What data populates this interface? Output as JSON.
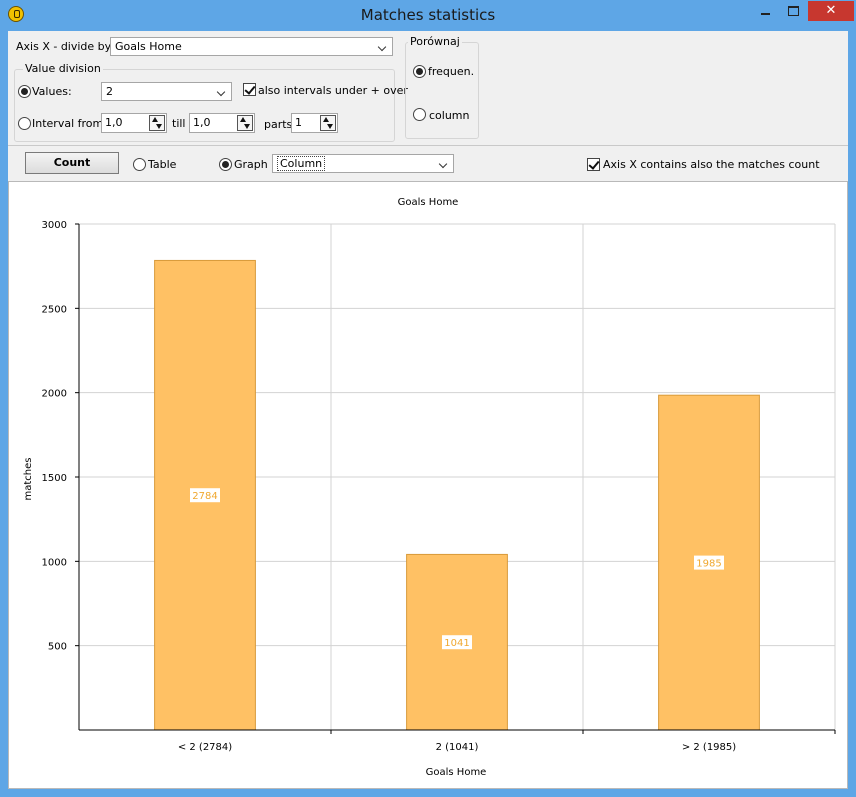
{
  "window": {
    "title": "Matches statistics",
    "close_glyph": "✕"
  },
  "controls": {
    "axis_x_label": "Axis X - divide by",
    "axis_x_value": "Goals Home",
    "value_division_title": "Value division",
    "values_label": "Values:",
    "values_value": "2",
    "also_intervals_label": "also intervals under + over",
    "also_intervals_checked": true,
    "interval_from_label": "Interval from",
    "interval_from_value": "1,0",
    "till_label": "till",
    "till_value": "1,0",
    "parts_label": "parts",
    "parts_value": "1",
    "compare_title": "Porównaj",
    "compare_frequen_label": "frequen.",
    "compare_column_label": "column",
    "values_selected": true,
    "frequen_selected": true
  },
  "toolbar": {
    "count_label": "Count",
    "table_label": "Table",
    "graph_label": "Graph",
    "graph_selected": true,
    "graph_type": "Column",
    "axis_x_count_label": "Axis X contains also the matches count",
    "axis_x_count_checked": true
  },
  "chart_data": {
    "type": "bar",
    "title": "Goals Home",
    "xlabel": "Goals Home",
    "ylabel": "matches",
    "categories": [
      "< 2 (2784)",
      "2 (1041)",
      "> 2 (1985)"
    ],
    "values": [
      2784,
      1041,
      1985
    ],
    "ylim": [
      0,
      3000
    ],
    "yticks": [
      500,
      1000,
      1500,
      2000,
      2500,
      3000
    ],
    "grid": true,
    "legend": "none",
    "bar_color": "#ffc164",
    "bar_edge_color": "#d89a3a"
  }
}
